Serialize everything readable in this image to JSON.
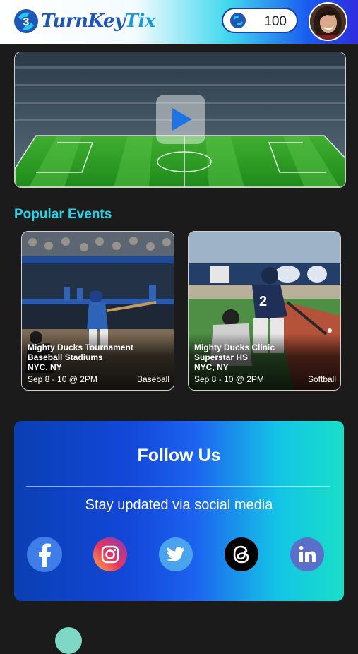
{
  "header": {
    "logo_text_1": "TurnKey",
    "logo_text_2": "Tix",
    "token_count": "100"
  },
  "video": {
    "play_icon": "play-icon"
  },
  "section_title": "Popular Events",
  "events": [
    {
      "title": "Mighty Ducks Tournament",
      "venue": "Baseball Stadiums",
      "location": "NYC, NY",
      "date": "Sep 8 - 10 @ 2PM",
      "sport": "Baseball"
    },
    {
      "title": "Mighty Ducks Clinic",
      "venue": "Superstar HS",
      "location": "NYC, NY",
      "date": "Sep 8 - 10 @ 2PM",
      "sport": "Softball"
    }
  ],
  "follow": {
    "title": "Follow Us",
    "subtitle": "Stay updated via social media",
    "icons": [
      "facebook-icon",
      "instagram-icon",
      "twitter-icon",
      "threads-icon",
      "linkedin-icon"
    ]
  },
  "colors": {
    "accent": "#28d3ea",
    "background": "#1b1b1b",
    "brand_blue": "#1f57b8"
  }
}
